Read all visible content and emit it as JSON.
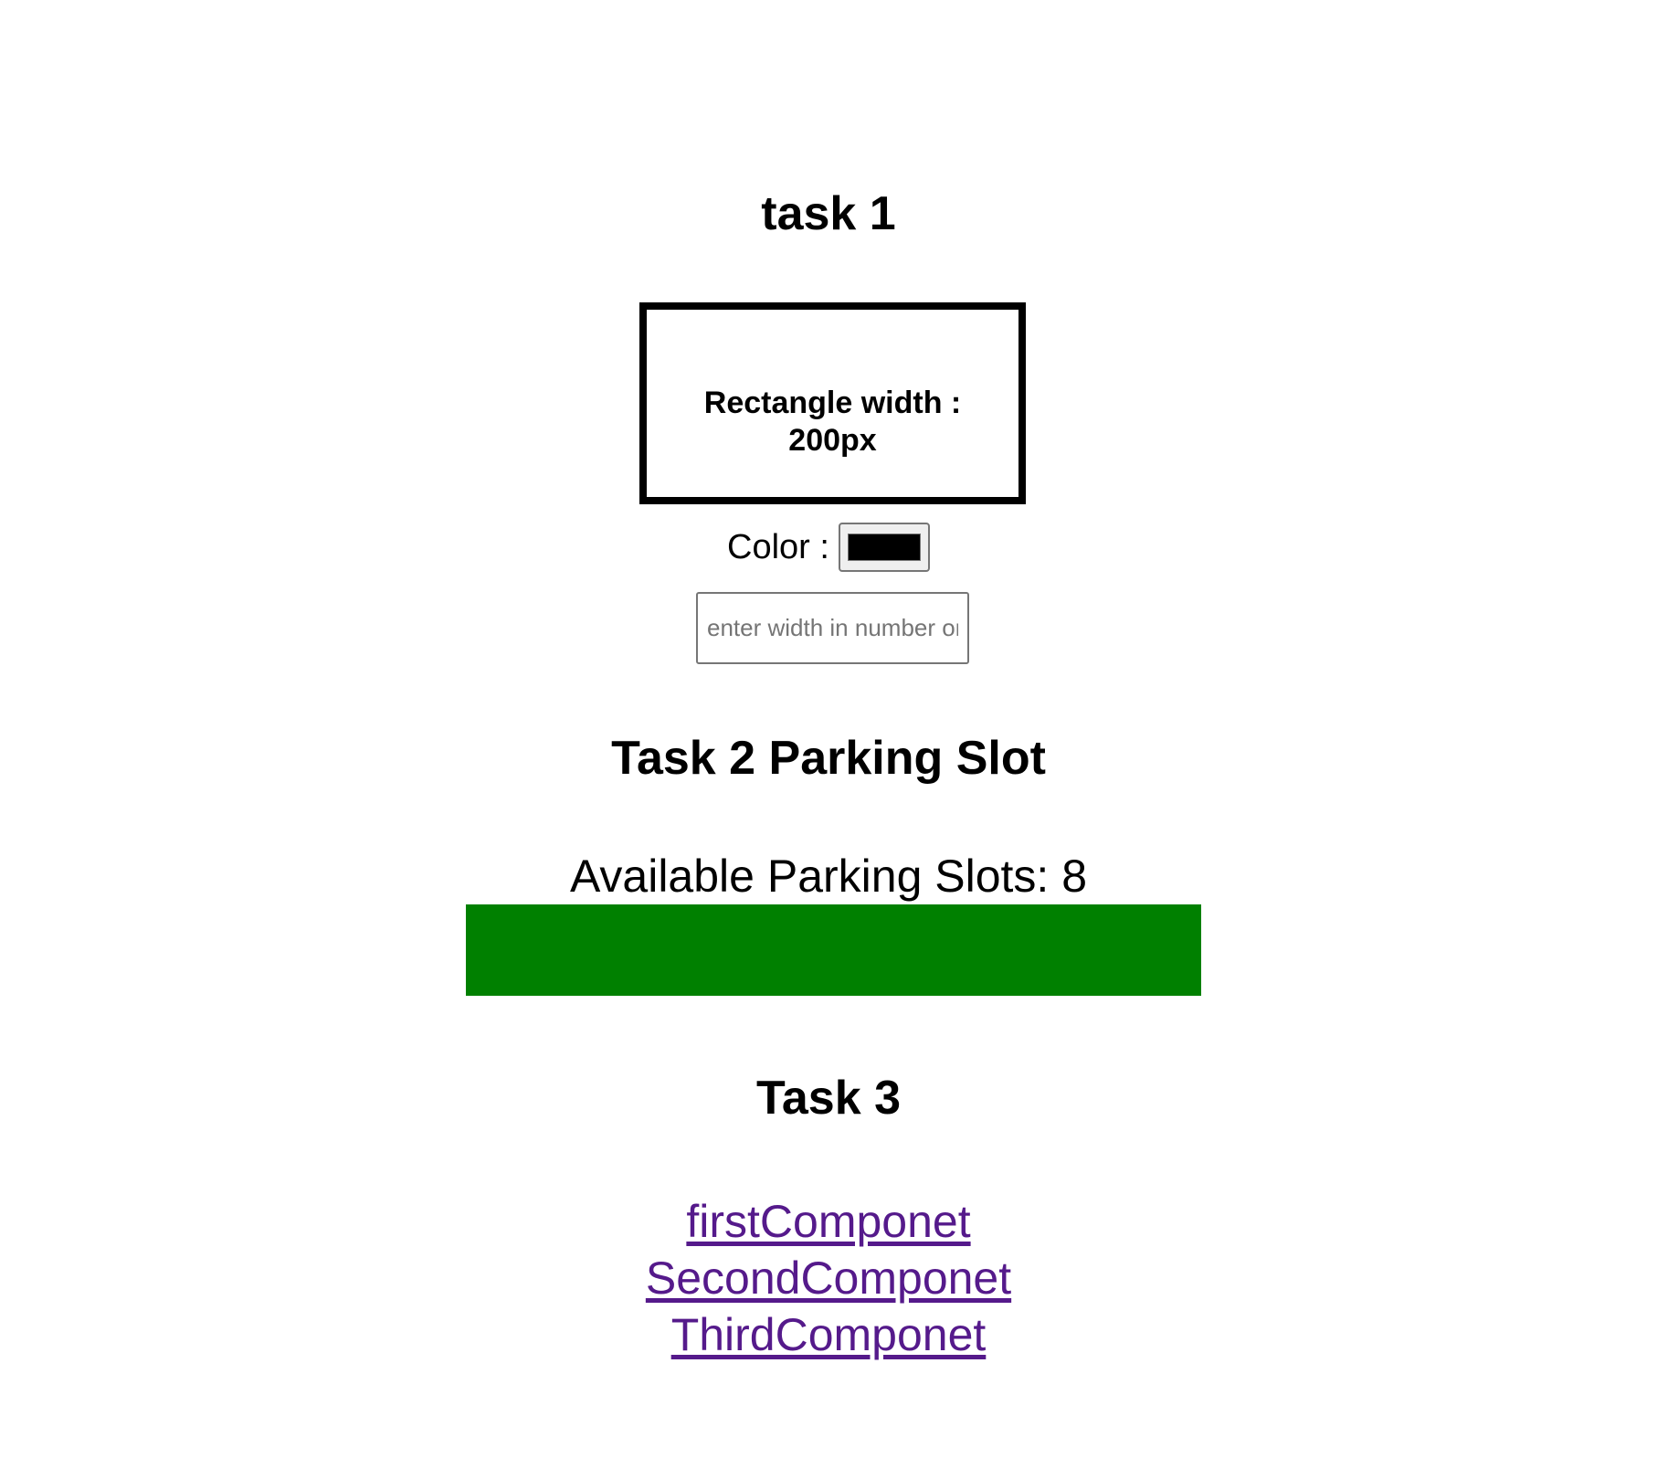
{
  "task1": {
    "heading": "task 1",
    "rectangle_label_line1": "Rectangle width :",
    "rectangle_label_line2": "200px",
    "rectangle_border_color": "#000000",
    "color_label": "Color :",
    "color_value": "#000000",
    "width_input": {
      "value": "",
      "placeholder": "enter width in number only"
    }
  },
  "task2": {
    "heading": "Task 2 Parking Slot",
    "available_text": "Available Parking Slots: 8",
    "bar_color": "#008000"
  },
  "task3": {
    "heading": "Task 3",
    "links": [
      {
        "label": "firstComponet"
      },
      {
        "label": "SecondComponet"
      },
      {
        "label": "ThirdComponet"
      }
    ],
    "link_color": "#551a8b"
  }
}
